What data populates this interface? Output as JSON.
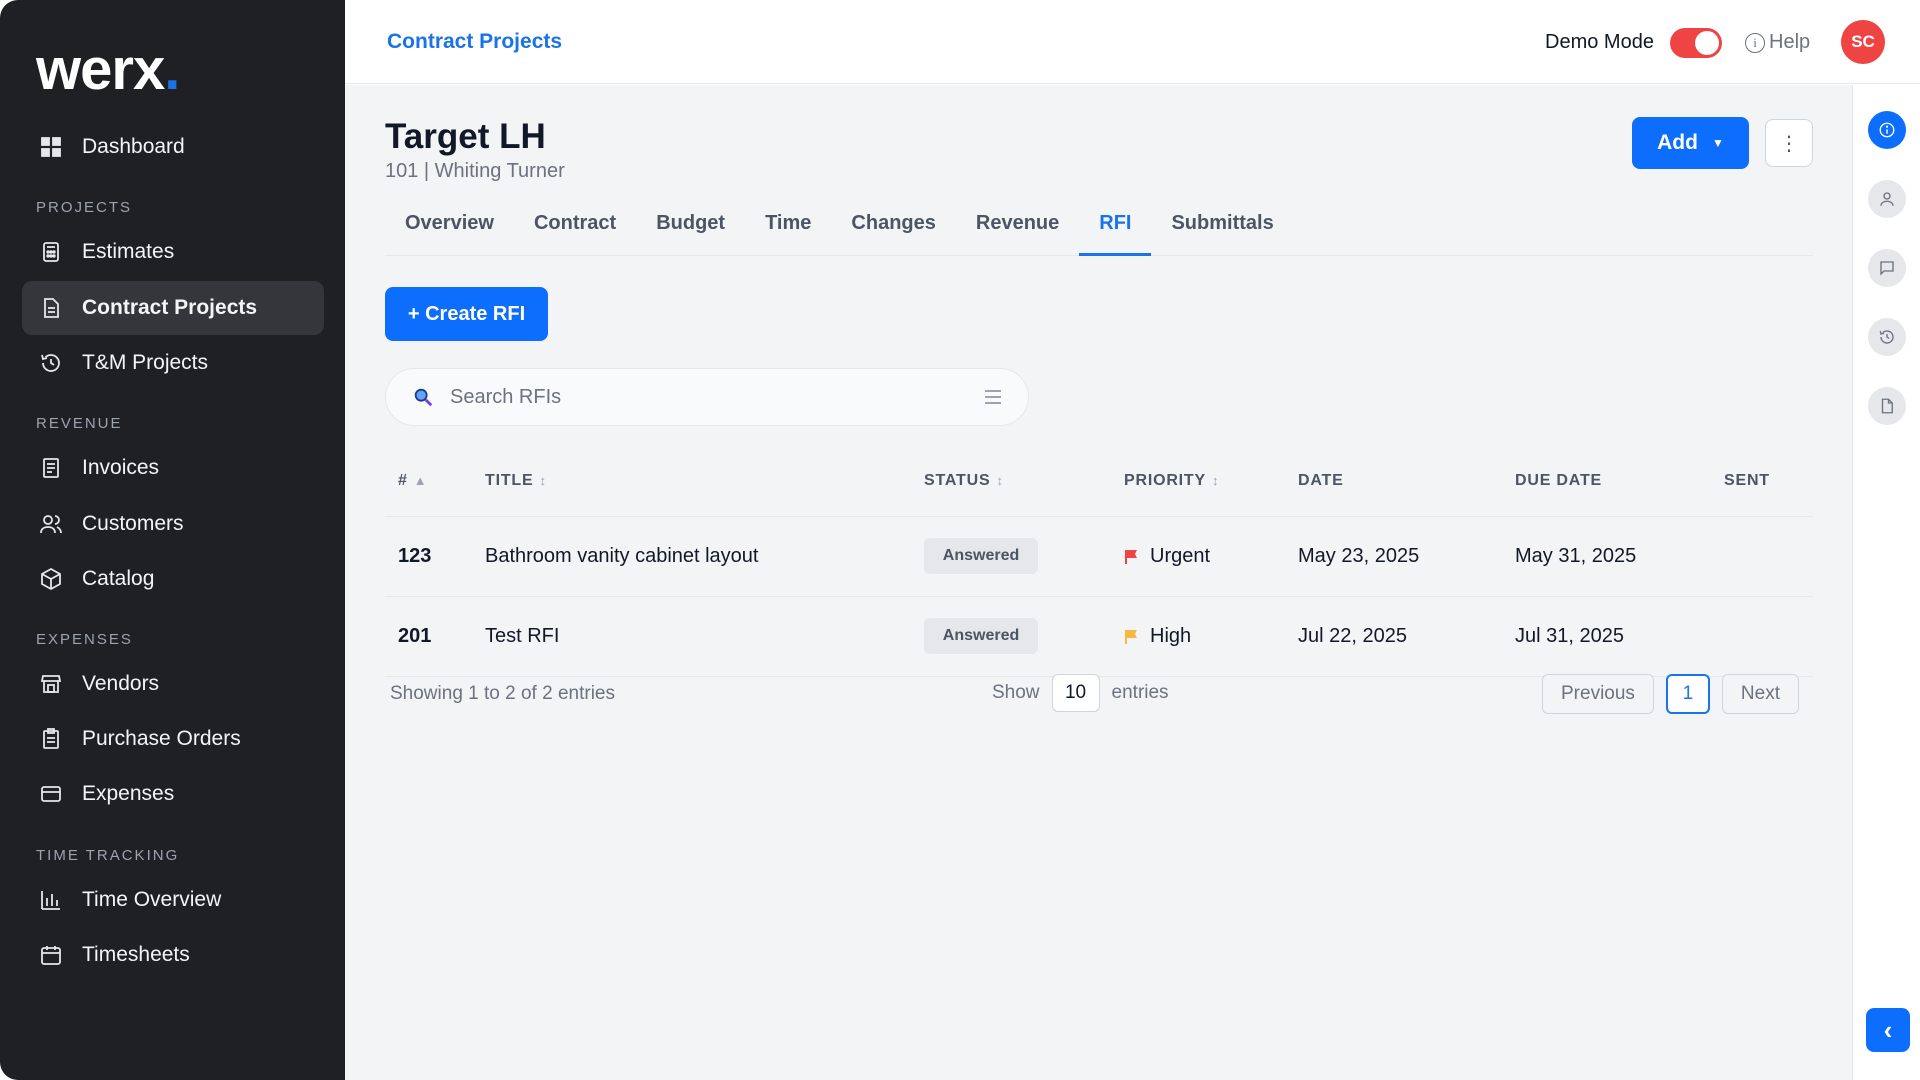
{
  "app": {
    "logo_text": "werx",
    "logo_dot": "."
  },
  "sidebar": {
    "dashboard": "Dashboard",
    "sections": {
      "projects": "PROJECTS",
      "revenue": "REVENUE",
      "expenses": "EXPENSES",
      "time_tracking": "TIME TRACKING"
    },
    "items": {
      "estimates": "Estimates",
      "contract_projects": "Contract Projects",
      "tm_projects": "T&M Projects",
      "invoices": "Invoices",
      "customers": "Customers",
      "catalog": "Catalog",
      "vendors": "Vendors",
      "purchase_orders": "Purchase Orders",
      "expenses": "Expenses",
      "time_overview": "Time Overview",
      "timesheets": "Timesheets"
    }
  },
  "topbar": {
    "breadcrumb": "Contract Projects",
    "demo_mode_label": "Demo Mode",
    "demo_mode_on": true,
    "help_label": "Help",
    "avatar_initials": "SC"
  },
  "project": {
    "title": "Target LH",
    "subtitle": "101 | Whiting Turner",
    "add_label": "Add",
    "tabs": [
      "Overview",
      "Contract",
      "Budget",
      "Time",
      "Changes",
      "Revenue",
      "RFI",
      "Submittals"
    ],
    "active_tab": "RFI"
  },
  "rfi": {
    "create_label": "+ Create RFI",
    "search_placeholder": "Search RFIs",
    "columns": {
      "num": "#",
      "title": "TITLE",
      "status": "STATUS",
      "priority": "PRIORITY",
      "date": "DATE",
      "due_date": "DUE DATE",
      "sent": "SENT"
    },
    "rows": [
      {
        "num": "123",
        "title": "Bathroom vanity cabinet layout",
        "status": "Answered",
        "priority": "Urgent",
        "priority_color": "#ef4444",
        "date": "May 23, 2025",
        "due_date": "May 31, 2025",
        "sent": ""
      },
      {
        "num": "201",
        "title": "Test RFI",
        "status": "Answered",
        "priority": "High",
        "priority_color": "#f5b942",
        "date": "Jul 22, 2025",
        "due_date": "Jul 31, 2025",
        "sent": ""
      }
    ],
    "footer": {
      "showing": "Showing 1 to 2 of 2 entries",
      "show_label": "Show",
      "page_size": "10",
      "entries_label": "entries",
      "previous": "Previous",
      "current_page": "1",
      "next": "Next"
    }
  },
  "colors": {
    "accent": "#0d6efd",
    "sidebar_bg": "#1e2024",
    "demo_toggle": "#ef4444"
  }
}
